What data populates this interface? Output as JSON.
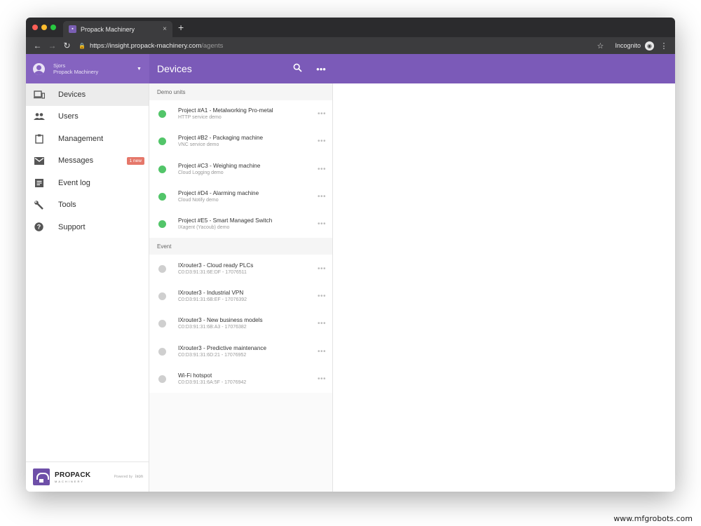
{
  "browser": {
    "tab_title": "Propack Machinery",
    "tab_close": "×",
    "new_tab": "+",
    "url_host": "https://insight.propack-machinery.com",
    "url_path": "/agents",
    "incognito_label": "Incognito"
  },
  "user": {
    "name": "Sjors",
    "company": "Propack Machinery"
  },
  "devices_header": {
    "title": "Devices"
  },
  "sidebar": {
    "items": [
      {
        "label": "Devices",
        "icon": "devices-icon",
        "active": true
      },
      {
        "label": "Users",
        "icon": "users-icon"
      },
      {
        "label": "Management",
        "icon": "clipboard-icon"
      },
      {
        "label": "Messages",
        "icon": "mail-icon",
        "badge": "1 new"
      },
      {
        "label": "Event log",
        "icon": "event-log-icon"
      },
      {
        "label": "Tools",
        "icon": "wrench-icon"
      },
      {
        "label": "Support",
        "icon": "help-icon"
      }
    ],
    "footer": {
      "logo_name": "PROPACK",
      "logo_sub": "MACHINERY",
      "powered_by": "Powered by",
      "ixon": "ixon"
    }
  },
  "sections": [
    {
      "title": "Demo units",
      "rows": [
        {
          "title": "Project #A1 - Metalworking Pro-metal",
          "subtitle": "HTTP service demo",
          "status": "online"
        },
        {
          "title": "Project #B2 - Packaging machine",
          "subtitle": "VNC service demo",
          "status": "online"
        },
        {
          "title": "Project #C3 - Weighing machine",
          "subtitle": "Cloud Logging demo",
          "status": "online"
        },
        {
          "title": "Project #D4 - Alarming machine",
          "subtitle": "Cloud Notify demo",
          "status": "online"
        },
        {
          "title": "Project #E5 - Smart Managed Switch",
          "subtitle": "IXagent (Yacoub) demo",
          "status": "online"
        }
      ]
    },
    {
      "title": "Event",
      "rows": [
        {
          "title": "IXrouter3 - Cloud ready PLCs",
          "subtitle": "C0:D3:91:31:6E:DF - 17076511",
          "status": "offline"
        },
        {
          "title": "IXrouter3 - Industrial VPN",
          "subtitle": "C0:D3:91:31:6B:EF - 17076392",
          "status": "offline"
        },
        {
          "title": "IXrouter3 - New business models",
          "subtitle": "C0:D3:91:31:6B:A3 - 17076382",
          "status": "offline"
        },
        {
          "title": "IXrouter3 - Predictive maintenance",
          "subtitle": "C0:D3:91:31:6D:21 - 17076952",
          "status": "offline"
        },
        {
          "title": "Wi-Fi hotspot",
          "subtitle": "C0:D3:91:31:6A:5F - 17076942",
          "status": "offline"
        }
      ]
    }
  ],
  "colors": {
    "accent": "#7b5ab8",
    "online": "#52c569",
    "offline": "#cfcfcf",
    "badge": "#e5776a"
  },
  "caption": "www.mfgrobots.com"
}
